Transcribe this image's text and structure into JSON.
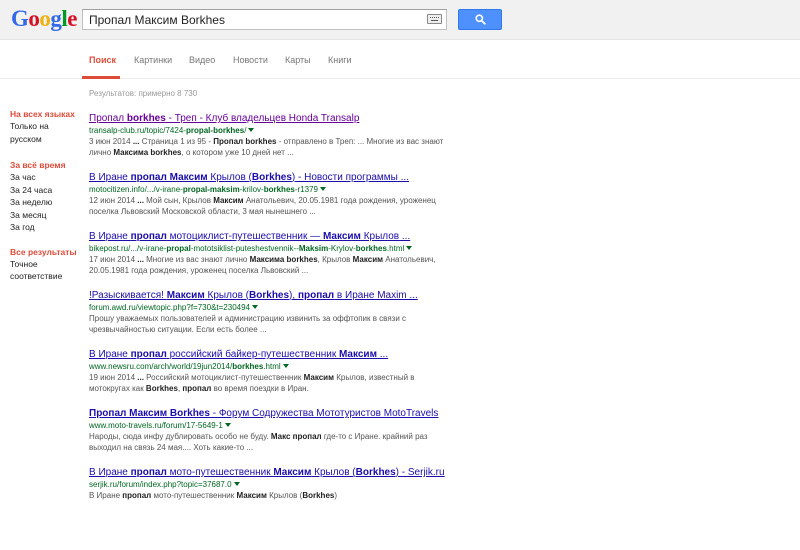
{
  "logo": {
    "g1": "G",
    "o1": "o",
    "o2": "o",
    "g2": "g",
    "l": "l",
    "e": "e"
  },
  "search": {
    "query": "Пропал Максим Borkhes"
  },
  "tabs": [
    {
      "label": "Поиск",
      "active": true
    },
    {
      "label": "Картинки"
    },
    {
      "label": "Видео"
    },
    {
      "label": "Новости"
    },
    {
      "label": "Карты"
    },
    {
      "label": "Книги"
    }
  ],
  "stats": "Результатов: примерно 8 730",
  "leftnav": {
    "lang_head": "На всех языках",
    "lang_item_1": "Только на",
    "lang_item_2": "русском",
    "time_head": "За всё время",
    "time_items": [
      "За час",
      "За 24 часа",
      "За неделю",
      "За месяц",
      "За год"
    ],
    "results_head": "Все результаты",
    "results_item_1": "Точное",
    "results_item_2": "соответствие"
  },
  "results": [
    {
      "title_html": "Пропал <b>borkhes</b> - Треп - Клуб владельцев Honda Transalp",
      "url_html": "transalp-club.ru/topic/7424-<b>propal-borkhes</b>/",
      "snippet_html": "3 июн 2014 <b>...</b> Страница 1 из 95 - <b>Пропал borkhes</b> - отправлено в Треп: ... Многие из вас знают лично <b>Максима borkhes</b>, о котором уже 10 дней нет ...",
      "visited": true
    },
    {
      "title_html": "В Иране <b>пропал Максим</b> Крылов (<b>Borkhes</b>) - Новости программы ...",
      "url_html": "motocitizen.info/.../v-irane-<b>propal-maksim</b>-krilov-<b>borkhes</b>-r1379",
      "snippet_html": "12 июн 2014 <b>...</b> Мой сын, Крылов <b>Максим</b> Анатольевич, 20.05.1981 года рождения, уроженец поселка Львовский Московской области, 3 мая нынешнего ...",
      "visited": false
    },
    {
      "title_html": "В Иране <b>пропал</b> мотоциклист-путешественник — <b>Максим</b> Крылов ...",
      "url_html": "bikepost.ru/.../v-irane-<b>propal</b>-mototsiklist-puteshestvennik--<b>Maksim</b>-Krylov-<b>borkhes</b>.html",
      "snippet_html": "17 июн 2014 <b>...</b> Многие из вас знают лично <b>Максима borkhes</b>, Крылов <b>Максим</b> Анатольевич, 20.05.1981 года рождения, уроженец поселка Львовский ...",
      "visited": false
    },
    {
      "title_html": "!Разыскивается! <b>Максим</b> Крылов (<b>Borkhes</b>), <b>пропал</b> в Иране Maxim ...",
      "url_html": "forum.awd.ru/viewtopic.php?f=730&amp;t=230494",
      "snippet_html": "Прошу уважаемых пользователей и администрацию извинить за оффтопик в связи с чрезвычайностью ситуации. Если есть более ...",
      "visited": false
    },
    {
      "title_html": "В Иране <b>пропал</b> российский байкер-путешественник <b>Максим</b> ...",
      "url_html": "www.newsru.com/arch/world/19jun2014/<b>borkhes</b>.html",
      "snippet_html": "19 июн 2014 <b>...</b> Российский мотоциклист-путешественник <b>Максим</b> Крылов, известный в мотокругах как <b>Borkhes</b>, <b>пропал</b> во время поездки в Иран.",
      "visited": false
    },
    {
      "title_html": "<b>Пропал Максим Borkhes</b> - Форум Содружества Мототуристов MotoTravels",
      "url_html": "www.moto-travels.ru/forum/17-5649-1",
      "snippet_html": "Народы, сюда инфу дублировать особо не буду. <b>Макс пропал</b> где-то с Иране. крайний раз выходил на связь 24 мая.... Хоть какие-то ...",
      "visited": false
    },
    {
      "title_html": "В Иране <b>пропал</b> мото-путешественник <b>Максим</b> Крылов (<b>Borkhes</b>) - Serjik.ru",
      "url_html": "serjik.ru/forum/index.php?topic=37687.0",
      "snippet_html": "В Иране <b>пропал</b> мото-путешественник <b>Максим</b> Крылов (<b>Borkhes</b>)",
      "visited": false
    }
  ]
}
